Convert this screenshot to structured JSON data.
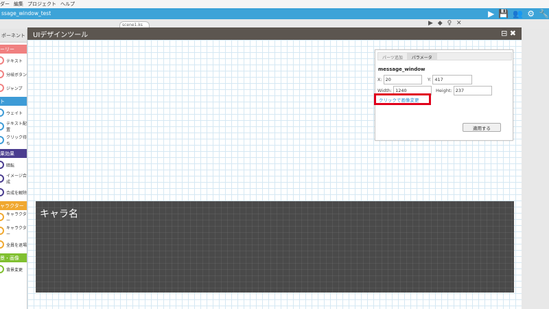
{
  "menu": {
    "items": [
      "ダー",
      "編集",
      "プロジェクト",
      "ヘルプ"
    ]
  },
  "project": {
    "name": "ssage_window_test"
  },
  "toolbar": {
    "play": "▶",
    "save": "💾",
    "users": "👥",
    "gear": "⚙",
    "wrench": "🔧"
  },
  "scene_tab": {
    "label": "scene1.ks ⓧ"
  },
  "tab_icons": "▶ ◆ ♀ ✕",
  "left": {
    "components_tab": "ポーネント",
    "categories": [
      {
        "label": "ーリー",
        "color": "#f08080"
      },
      {
        "label": "ト",
        "color": "#3d9bd6"
      },
      {
        "label": "果効果",
        "color": "#4a3d8f"
      },
      {
        "label": "ャラクター",
        "color": "#f0a830"
      },
      {
        "label": "景・画像",
        "color": "#80c030"
      }
    ],
    "items_story": [
      "テキスト",
      "分岐ボタン",
      "ジャンプ"
    ],
    "items_system": [
      "ウェイト",
      "テキスト配置",
      "クリック待ち"
    ],
    "items_effect": [
      "暗転",
      "イメージ合成",
      "合成を解除"
    ],
    "items_chara": [
      "キャラクター",
      "キャラクター",
      "全員を退場"
    ],
    "items_bg": [
      "背景変更"
    ]
  },
  "dialog": {
    "title": "UIデザインツール",
    "icons": "⊟ ✖"
  },
  "message_window": {
    "name": "キャラ名"
  },
  "params": {
    "tabs": [
      "パーツ追加",
      "パラメータ"
    ],
    "name": "message_window",
    "x_label": "X:",
    "x": "20",
    "y_label": "Y:",
    "y": "417",
    "w_label": "Width:",
    "w": "1240",
    "h_label": "Height:",
    "h": "237",
    "change_image": "クリックで画像変更",
    "apply": "適用する"
  }
}
